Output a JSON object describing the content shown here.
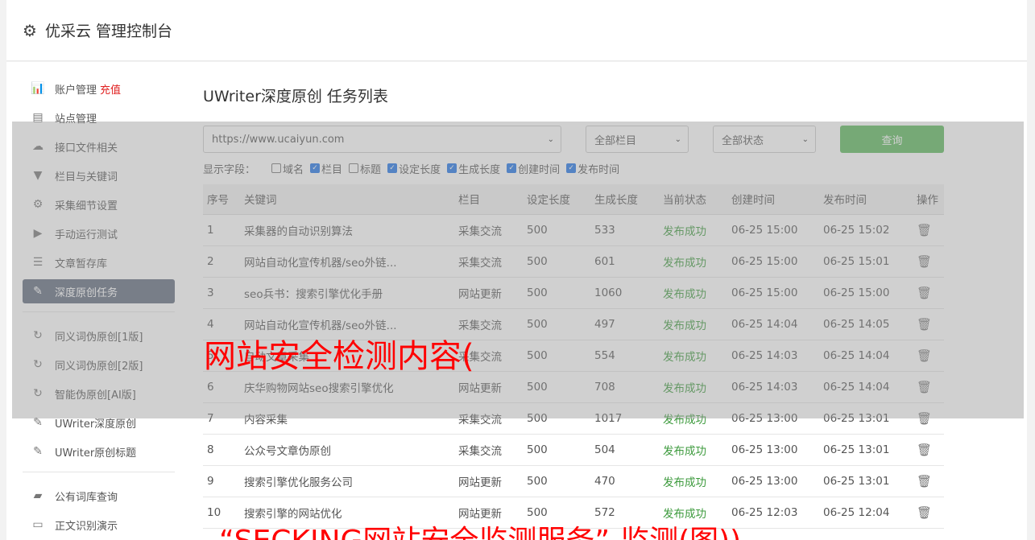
{
  "header": {
    "title": "优采云 管理控制台",
    "icon": "gear-icon"
  },
  "sidebar": {
    "group1": [
      {
        "icon": "bar-chart-icon",
        "glyph": "📊",
        "label": "账户管理",
        "extra": "充值"
      },
      {
        "icon": "server-icon",
        "glyph": "▤",
        "label": "站点管理"
      },
      {
        "icon": "cloud-upload-icon",
        "glyph": "☁",
        "label": "接口文件相关"
      },
      {
        "icon": "filter-icon",
        "glyph": "▼",
        "label": "栏目与关键词"
      },
      {
        "icon": "cogs-icon",
        "glyph": "⚙",
        "label": "采集细节设置"
      },
      {
        "icon": "play-icon",
        "glyph": "▶",
        "label": "手动运行测试"
      },
      {
        "icon": "database-icon",
        "glyph": "☰",
        "label": "文章暂存库"
      },
      {
        "icon": "edit-icon",
        "glyph": "✎",
        "label": "深度原创任务",
        "active": true
      }
    ],
    "group2": [
      {
        "icon": "refresh-icon",
        "glyph": "↻",
        "label": "同义词伪原创[1版]"
      },
      {
        "icon": "refresh-icon",
        "glyph": "↻",
        "label": "同义词伪原创[2版]"
      },
      {
        "icon": "refresh-icon",
        "glyph": "↻",
        "label": "智能伪原创[AI版]"
      },
      {
        "icon": "edit-icon",
        "glyph": "✎",
        "label": "UWriter深度原创"
      },
      {
        "icon": "edit-icon",
        "glyph": "✎",
        "label": "UWriter原创标题"
      }
    ],
    "group3": [
      {
        "icon": "book-icon",
        "glyph": "▰",
        "label": "公有词库查询"
      },
      {
        "icon": "desktop-icon",
        "glyph": "▭",
        "label": "正文识别演示"
      }
    ]
  },
  "main": {
    "title": "UWriter深度原创 任务列表",
    "filters": {
      "domain": "https://www.ucaiyun.com",
      "column": "全部栏目",
      "status": "全部状态",
      "query_label": "查询"
    },
    "fields_label": "显示字段：",
    "fields": [
      {
        "label": "域名",
        "checked": false
      },
      {
        "label": "栏目",
        "checked": true
      },
      {
        "label": "标题",
        "checked": false
      },
      {
        "label": "设定长度",
        "checked": true
      },
      {
        "label": "生成长度",
        "checked": true
      },
      {
        "label": "创建时间",
        "checked": true
      },
      {
        "label": "发布时间",
        "checked": true
      }
    ],
    "columns": [
      "序号",
      "关键词",
      "栏目",
      "设定长度",
      "生成长度",
      "当前状态",
      "创建时间",
      "发布时间",
      "操作"
    ],
    "rows": [
      [
        "1",
        "采集器的自动识别算法",
        "采集交流",
        "500",
        "533",
        "发布成功",
        "06-25 15:00",
        "06-25 15:02"
      ],
      [
        "2",
        "网站自动化宣传机器/seo外链...",
        "采集交流",
        "500",
        "601",
        "发布成功",
        "06-25 15:00",
        "06-25 15:01"
      ],
      [
        "3",
        "seo兵书：搜索引擎优化手册",
        "网站更新",
        "500",
        "1060",
        "发布成功",
        "06-25 15:00",
        "06-25 15:00"
      ],
      [
        "4",
        "网站自动化宣传机器/seo外链...",
        "采集交流",
        "500",
        "497",
        "发布成功",
        "06-25 14:04",
        "06-25 14:05"
      ],
      [
        "5",
        "自动文章采集",
        "采集交流",
        "500",
        "554",
        "发布成功",
        "06-25 14:03",
        "06-25 14:04"
      ],
      [
        "6",
        "庆华购物网站seo搜索引擎优化",
        "网站更新",
        "500",
        "708",
        "发布成功",
        "06-25 14:03",
        "06-25 14:04"
      ],
      [
        "7",
        "内容采集",
        "采集交流",
        "500",
        "1017",
        "发布成功",
        "06-25 13:00",
        "06-25 13:01"
      ],
      [
        "8",
        "公众号文章伪原创",
        "采集交流",
        "500",
        "504",
        "发布成功",
        "06-25 13:00",
        "06-25 13:01"
      ],
      [
        "9",
        "搜索引擎优化服务公司",
        "网站更新",
        "500",
        "470",
        "发布成功",
        "06-25 13:00",
        "06-25 13:01"
      ],
      [
        "10",
        "搜索引擎的网站优化",
        "网站更新",
        "500",
        "572",
        "发布成功",
        "06-25 12:03",
        "06-25 12:04"
      ]
    ]
  },
  "watermarks": {
    "line1": "网站安全检测内容(",
    "line2": "“SECKING网站安全监测服务”-监测(图))"
  },
  "colors": {
    "active_nav": "#5f6a7d",
    "query_button": "#5cb85c",
    "success": "#3c9a3c",
    "watermark": "#ff0000"
  }
}
